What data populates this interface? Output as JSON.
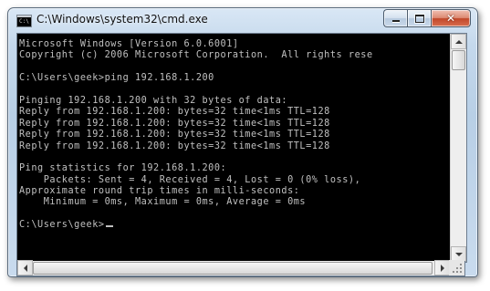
{
  "window": {
    "title": "C:\\Windows\\system32\\cmd.exe",
    "icon": "cmd-icon",
    "icon_text": "C:\\"
  },
  "controls": {
    "minimize": "minimize-icon",
    "maximize": "maximize-icon",
    "close": "close-icon",
    "close_glyph": "✕"
  },
  "console": {
    "background": "#000000",
    "foreground": "#c0c0c0",
    "lines": [
      "Microsoft Windows [Version 6.0.6001]",
      "Copyright (c) 2006 Microsoft Corporation.  All rights rese",
      "",
      "C:\\Users\\geek>ping 192.168.1.200",
      "",
      "Pinging 192.168.1.200 with 32 bytes of data:",
      "Reply from 192.168.1.200: bytes=32 time<1ms TTL=128",
      "Reply from 192.168.1.200: bytes=32 time<1ms TTL=128",
      "Reply from 192.168.1.200: bytes=32 time<1ms TTL=128",
      "Reply from 192.168.1.200: bytes=32 time<1ms TTL=128",
      "",
      "Ping statistics for 192.168.1.200:",
      "    Packets: Sent = 4, Received = 4, Lost = 0 (0% loss),",
      "Approximate round trip times in milli-seconds:",
      "    Minimum = 0ms, Maximum = 0ms, Average = 0ms",
      "",
      "C:\\Users\\geek>"
    ]
  },
  "scrollbars": {
    "vertical": {
      "position": 0
    },
    "horizontal": {
      "position": 0
    }
  }
}
